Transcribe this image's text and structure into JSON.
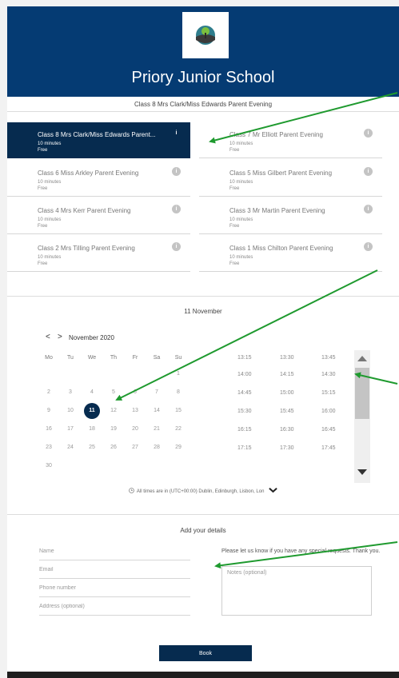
{
  "header": {
    "school_name": "Priory Junior School"
  },
  "event_title": "Class 8 Mrs Clark/Miss Edwards Parent Evening",
  "events": [
    {
      "title": "Class 8 Mrs Clark/Miss Edwards Parent...",
      "duration": "10 minutes",
      "price": "Free",
      "selected": true
    },
    {
      "title": "Class 7 Mr Elliott Parent Evening",
      "duration": "10 minutes",
      "price": "Free",
      "selected": false
    },
    {
      "title": "Class 6 Miss Arkley Parent Evening",
      "duration": "10 minutes",
      "price": "Free",
      "selected": false
    },
    {
      "title": "Class 5 Miss Gilbert Parent Evening",
      "duration": "10 minutes",
      "price": "Free",
      "selected": false
    },
    {
      "title": "Class 4 Mrs Kerr Parent Evening",
      "duration": "10 minutes",
      "price": "Free",
      "selected": false
    },
    {
      "title": "Class 3 Mr Martin Parent Evening",
      "duration": "10 minutes",
      "price": "Free",
      "selected": false
    },
    {
      "title": "Class 2 Mrs Tilling Parent Evening",
      "duration": "10 minutes",
      "price": "Free",
      "selected": false
    },
    {
      "title": "Class 1 Miss Chilton Parent Evening",
      "duration": "10 minutes",
      "price": "Free",
      "selected": false
    }
  ],
  "info_glyph": "i",
  "calendar": {
    "heading": "11 November",
    "month_label": "November 2020",
    "prev_glyph": "<",
    "next_glyph": ">",
    "weekdays": [
      "Mo",
      "Tu",
      "We",
      "Th",
      "Fr",
      "Sa",
      "Su"
    ],
    "weeks": [
      [
        "",
        "",
        "",
        "",
        "",
        "",
        "1"
      ],
      [
        "2",
        "3",
        "4",
        "5",
        "6",
        "7",
        "8"
      ],
      [
        "9",
        "10",
        "11",
        "12",
        "13",
        "14",
        "15"
      ],
      [
        "16",
        "17",
        "18",
        "19",
        "20",
        "21",
        "22"
      ],
      [
        "23",
        "24",
        "25",
        "26",
        "27",
        "28",
        "29"
      ],
      [
        "30",
        "",
        "",
        "",
        "",
        "",
        ""
      ]
    ],
    "selected_day": "11"
  },
  "timeslots": [
    [
      "13:15",
      "13:30",
      "13:45"
    ],
    [
      "14:00",
      "14:15",
      "14:30"
    ],
    [
      "14:45",
      "15:00",
      "15:15"
    ],
    [
      "15:30",
      "15:45",
      "16:00"
    ],
    [
      "16:15",
      "16:30",
      "16:45"
    ],
    [
      "17:15",
      "17:30",
      "17:45"
    ]
  ],
  "timezone_note": "All times are in (UTC+00:00) Dublin, Edinburgh, Lisbon, Lon",
  "details": {
    "heading": "Add your details",
    "name_placeholder": "Name",
    "email_placeholder": "Email",
    "phone_placeholder": "Phone number",
    "address_placeholder": "Address (optional)",
    "requests_text": "Please let us know if you have any special requests. Thank you.",
    "notes_placeholder": "Notes (optional)",
    "book_label": "Book"
  },
  "colors": {
    "brand": "#053b73",
    "selected": "#062b4f",
    "annotation_arrow": "#1f9a2f"
  },
  "icons": [
    "school-logo-icon",
    "info-icon",
    "chevron-left-icon",
    "chevron-right-icon",
    "clock-icon",
    "chevron-down-icon",
    "scroll-up-icon",
    "scroll-down-icon",
    "annotation-arrow-icon"
  ]
}
